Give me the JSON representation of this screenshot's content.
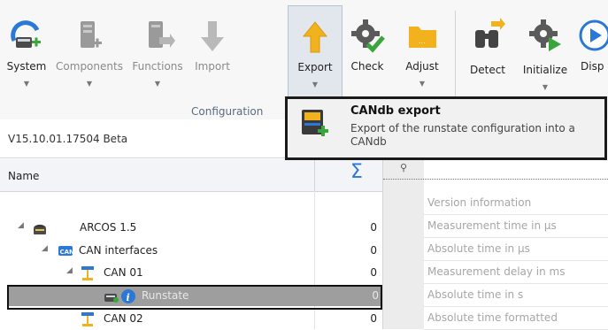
{
  "ribbon": {
    "buttons": [
      {
        "label": "System",
        "icon": "system-icon",
        "state": "enabled"
      },
      {
        "label": "Components",
        "icon": "components-icon",
        "state": "disabled"
      },
      {
        "label": "Functions",
        "icon": "functions-icon",
        "state": "disabled"
      },
      {
        "label": "Import",
        "icon": "import-arrow-icon",
        "state": "disabled"
      },
      {
        "label": "Export",
        "icon": "export-arrow-icon",
        "state": "active"
      },
      {
        "label": "Check",
        "icon": "check-gear-icon",
        "state": "enabled"
      },
      {
        "label": "Adjust",
        "icon": "folder-icon",
        "state": "enabled"
      },
      {
        "label": "Detect",
        "icon": "binoculars-icon",
        "state": "enabled"
      },
      {
        "label": "Initialize",
        "icon": "initialize-gear-icon",
        "state": "enabled"
      },
      {
        "label": "Disp",
        "icon": "play-circle-icon",
        "state": "enabled"
      }
    ],
    "group_label": "Configuration"
  },
  "tooltip": {
    "title": "CANdb export",
    "description": "Export of the runstate configuration into a CANdb"
  },
  "version": "V15.10.01.17504 Beta",
  "tree": {
    "header_name": "Name",
    "header_sum": "Σ",
    "rows": [
      {
        "label": "ARCOS 1.5",
        "count": "0",
        "icon": "device-icon"
      },
      {
        "label": "CAN interfaces",
        "count": "0",
        "icon": "can-icon"
      },
      {
        "label": "CAN 01",
        "count": "0",
        "icon": "can-node-icon"
      },
      {
        "label": "Runstate",
        "count": "0",
        "icon": "runstate-info-icon",
        "selected": true
      },
      {
        "label": "CAN 02",
        "count": "0",
        "icon": "can-node-icon"
      }
    ]
  },
  "properties": {
    "pin_symbol": "⚲",
    "items": [
      "Version information",
      "Measurement time in µs",
      "Absolute time in µs",
      "Measurement delay in ms",
      "Absolute time in s",
      "Absolute time formatted"
    ]
  },
  "colors": {
    "accent_blue": "#2b78d6",
    "export_arrow": "#f2b21d",
    "check_green": "#39a53a",
    "selected_row": "#9e9e9e"
  }
}
